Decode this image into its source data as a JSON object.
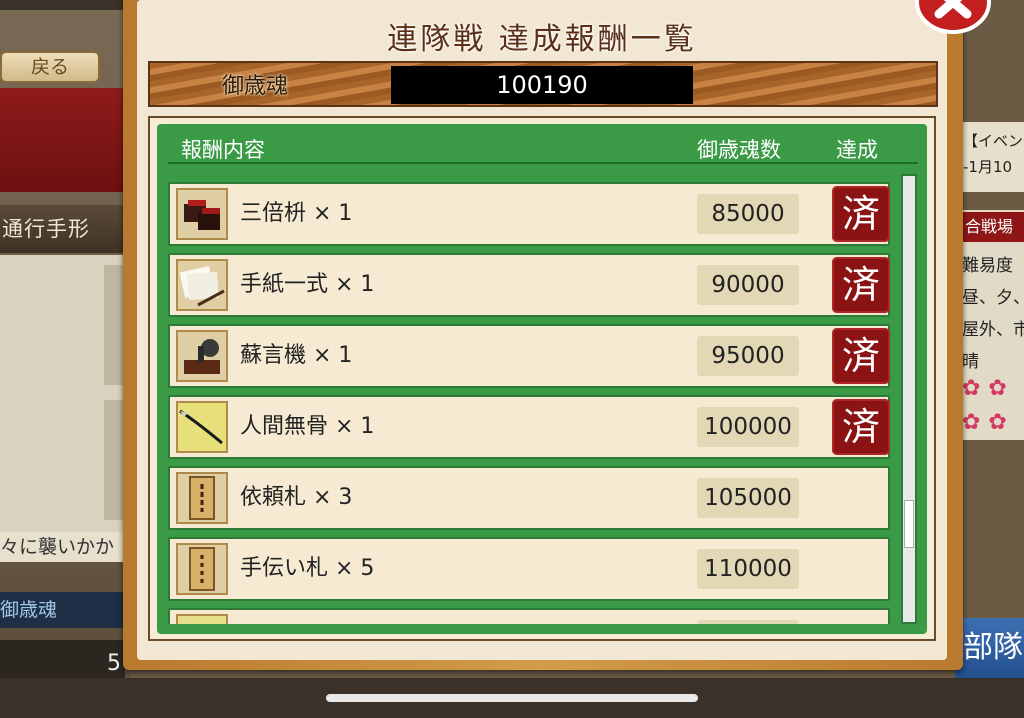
{
  "background": {
    "back_label": "戻る",
    "pass_label": "通行手形",
    "story_text": "々に襲いかか",
    "soul_label": "御歳魂",
    "soul_count_partial": "5",
    "event_text": "【イベン",
    "event_date": "-1月10",
    "battle_head": "合戦場",
    "battle_lines": [
      "難易度",
      "昼、夕、",
      "屋外、市",
      "晴"
    ],
    "butai_label": "部隊"
  },
  "dialog": {
    "title": "連隊戦 達成報酬一覧",
    "soul_caption": "御歳魂",
    "soul_value": "100190",
    "headers": {
      "content": "報酬内容",
      "count": "御歳魂数",
      "achieved": "達成"
    },
    "rows": [
      {
        "name": "三倍枡 × 1",
        "qty": "85000",
        "done": "済",
        "icon": "masu-box-icon"
      },
      {
        "name": "手紙一式 × 1",
        "qty": "90000",
        "done": "済",
        "icon": "letter-set-icon"
      },
      {
        "name": "蘇言機 × 1",
        "qty": "95000",
        "done": "済",
        "icon": "phonograph-icon"
      },
      {
        "name": "人間無骨 × 1",
        "qty": "100000",
        "done": "済",
        "icon": "spear-icon"
      },
      {
        "name": "依頼札 × 3",
        "qty": "105000",
        "done": "",
        "icon": "request-tag-icon"
      },
      {
        "name": "手伝い札 × 5",
        "qty": "110000",
        "done": "",
        "icon": "help-tag-icon"
      }
    ],
    "close_icon": "close-x-icon"
  },
  "colors": {
    "stamp_red": "#8b1313",
    "panel_green": "#3b9a46",
    "title_brown": "#5b2f18"
  }
}
